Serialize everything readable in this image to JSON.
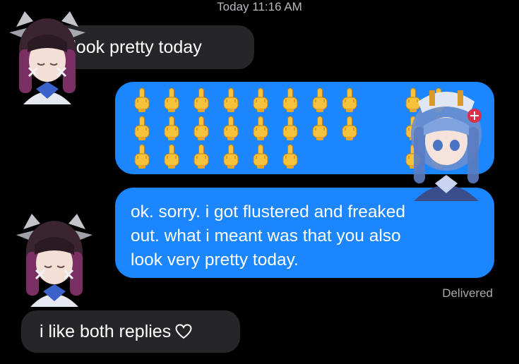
{
  "header": {
    "timestamp": "Today 11:16 AM"
  },
  "messages": [
    {
      "direction": "incoming",
      "text": "you look pretty today"
    },
    {
      "direction": "outgoing",
      "content": "emoji-grid",
      "emoji_icon": "middle-finger-emoji",
      "emoji_count": 29
    },
    {
      "direction": "outgoing",
      "text": "ok. sorry. i got flustered and freaked\nout. what i meant was that you also\nlook very pretty today."
    },
    {
      "direction": "incoming",
      "text": "i like both replies",
      "trailing_icon": "heart-outline-icon"
    }
  ],
  "status": {
    "delivered": "Delivered"
  },
  "colors": {
    "background": "#000000",
    "incoming_bubble": "#262629",
    "outgoing_bubble": "#1b86ff",
    "timestamp_text": "#b8b8bd"
  },
  "overlays": [
    {
      "icon": "anime-girl-avatar-dark-hair"
    },
    {
      "icon": "anime-girl-avatar-blue-hair"
    },
    {
      "icon": "anime-girl-avatar-dark-hair"
    }
  ]
}
